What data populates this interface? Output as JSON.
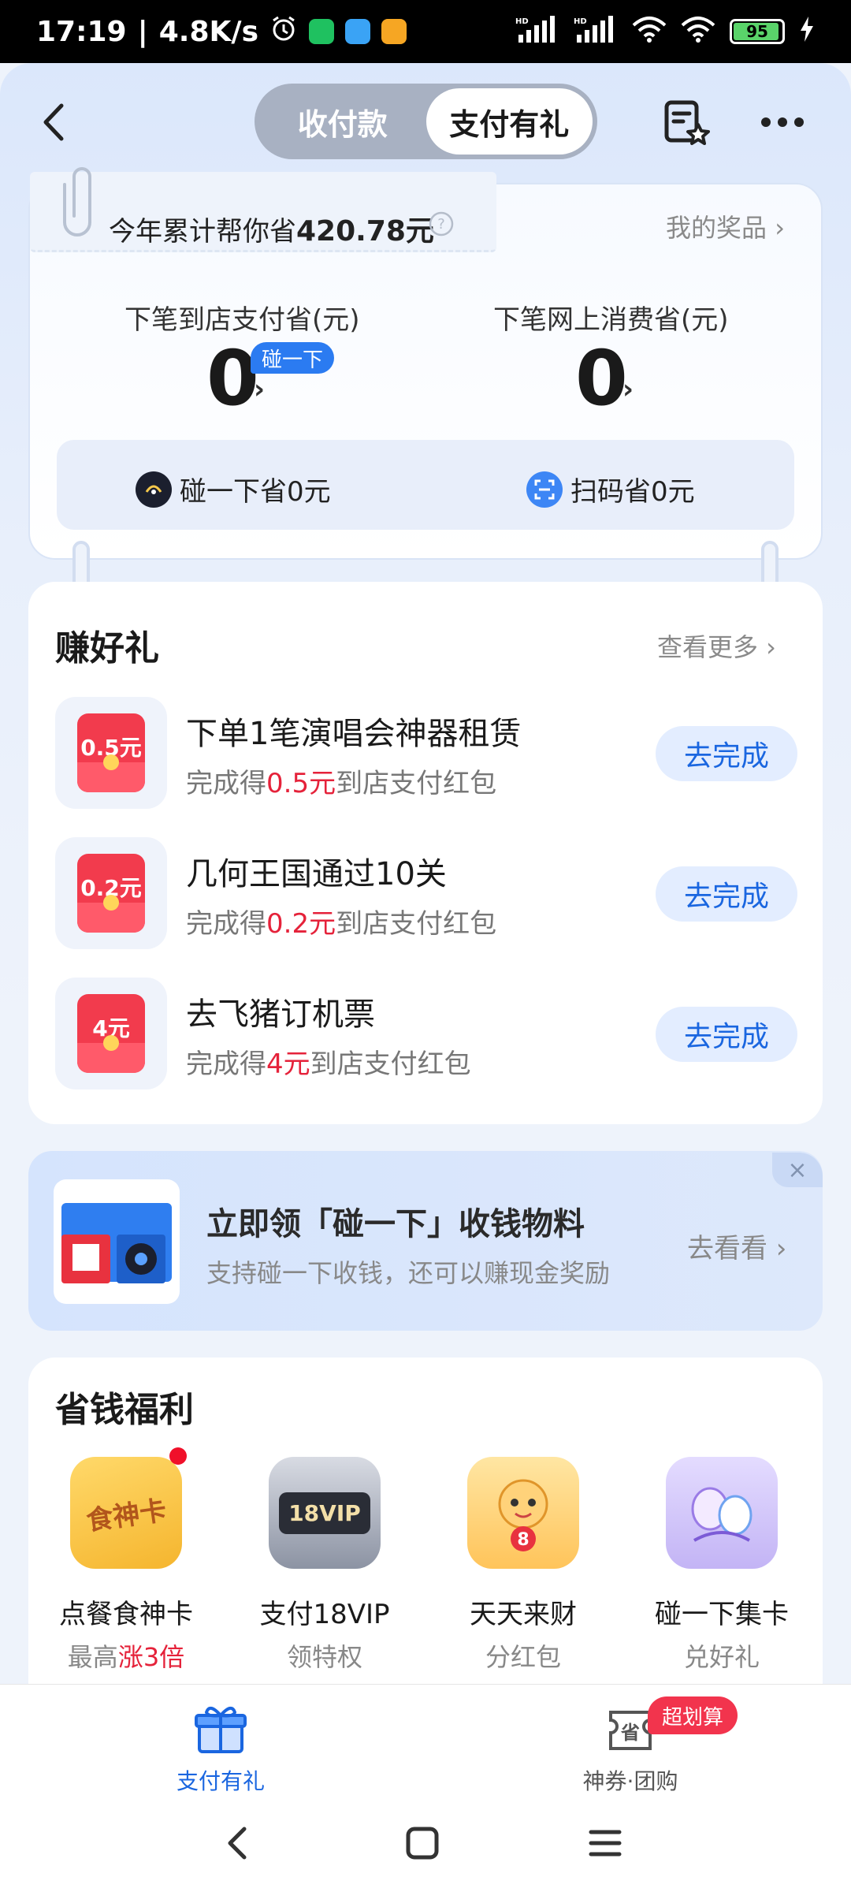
{
  "status_bar": {
    "time": "17:19",
    "speed": "4.8K/s",
    "battery": "95",
    "battery_level": 0.95
  },
  "header": {
    "tabs": [
      {
        "label": "收付款",
        "active": false
      },
      {
        "label": "支付有礼",
        "active": true
      }
    ]
  },
  "savings": {
    "year_prefix": "今年累计帮你省",
    "year_amount": "420.78元",
    "my_prize": "我的奖品 ›",
    "store_label": "下笔到店支付省(元)",
    "store_value": "0",
    "tap_badge": "碰一下",
    "online_label": "下笔网上消费省(元)",
    "online_value": "0",
    "arrow": "›",
    "tap_save": "碰一下省0元",
    "scan_save": "扫码省0元"
  },
  "earn": {
    "title": "赚好礼",
    "see_more": "查看更多 ›",
    "tasks": [
      {
        "badge": "0.5元",
        "title": "下单1笔演唱会神器租赁",
        "prefix": "完成得",
        "amount": "0.5元",
        "suffix": "到店支付红包",
        "button": "去完成"
      },
      {
        "badge": "0.2元",
        "title": "几何王国通过10关",
        "prefix": "完成得",
        "amount": "0.2元",
        "suffix": "到店支付红包",
        "button": "去完成"
      },
      {
        "badge": "4元",
        "title": "去飞猪订机票",
        "prefix": "完成得",
        "amount": "4元",
        "suffix": "到店支付红包",
        "button": "去完成"
      }
    ]
  },
  "promo": {
    "title": "立即领「碰一下」收钱物料",
    "subtitle": "支持碰一下收钱，还可以赚现金奖励",
    "action": "去看看 ›",
    "close": "×"
  },
  "welfare": {
    "title": "省钱福利",
    "items": [
      {
        "name": "点餐食神卡",
        "sub_prefix": "最高",
        "sub_highlight": "涨3倍",
        "icon_text": "食神卡"
      },
      {
        "name": "支付18VIP",
        "sub_prefix": "领特权",
        "sub_highlight": "",
        "icon_text": "18VIP"
      },
      {
        "name": "天天来财",
        "sub_prefix": "分红包",
        "sub_highlight": "",
        "icon_text": "8"
      },
      {
        "name": "碰一下集卡",
        "sub_prefix": "兑好礼",
        "sub_highlight": "",
        "icon_text": ""
      }
    ]
  },
  "tabbar": {
    "tabs": [
      {
        "label": "支付有礼",
        "active": true
      },
      {
        "label": "神券·团购",
        "active": false
      }
    ],
    "badge": "超划算",
    "coupon_icon_text": "省"
  },
  "colors": {
    "accent": "#1a66e0",
    "red": "#e5223a",
    "tab_active": "#1a66e0"
  }
}
